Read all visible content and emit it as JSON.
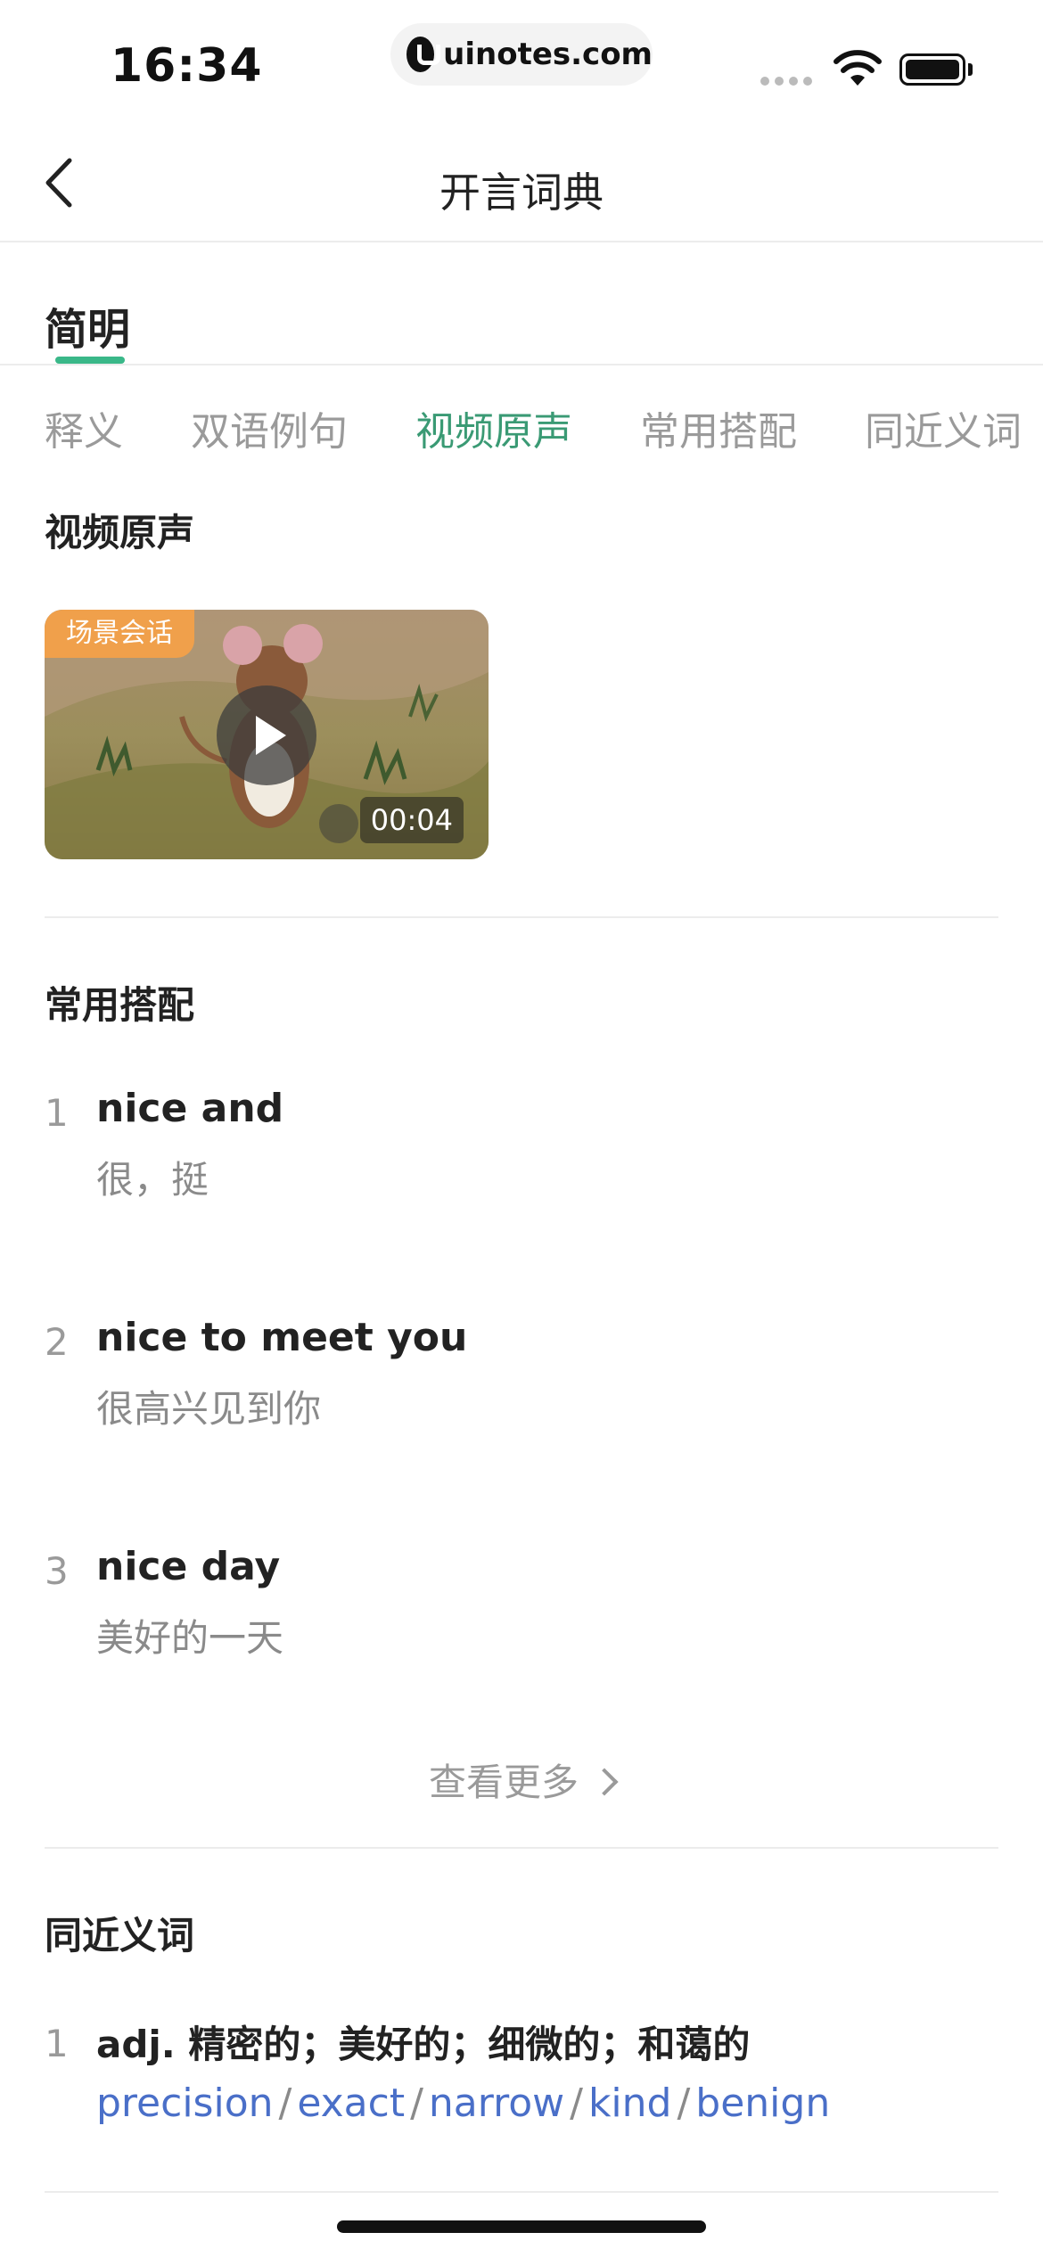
{
  "status_bar": {
    "time": "16:34",
    "url": "uinotes.com"
  },
  "nav": {
    "title": "开言词典"
  },
  "simple_tab": "简明",
  "section_tabs": [
    {
      "label": "释义",
      "active": false
    },
    {
      "label": "双语例句",
      "active": false
    },
    {
      "label": "视频原声",
      "active": true
    },
    {
      "label": "常用搭配",
      "active": false
    },
    {
      "label": "同近义词",
      "active": false
    }
  ],
  "video_section": {
    "heading": "视频原声",
    "badge": "场景会话",
    "duration": "00:04"
  },
  "collocations": {
    "heading": "常用搭配",
    "items": [
      {
        "num": "1",
        "en": "nice and",
        "cn": "很，挺"
      },
      {
        "num": "2",
        "en": "nice to meet you",
        "cn": "很高兴见到你"
      },
      {
        "num": "3",
        "en": "nice day",
        "cn": "美好的一天"
      }
    ],
    "more_label": "查看更多"
  },
  "synonyms": {
    "heading": "同近义词",
    "items": [
      {
        "num": "1",
        "definition": "adj. 精密的；美好的；细微的；和蔼的",
        "words": [
          "precision",
          "exact",
          "narrow",
          "kind",
          "benign"
        ]
      }
    ]
  },
  "colors": {
    "accent": "#3ab889",
    "active_tab": "#3a9a74",
    "link": "#4a6fc8",
    "badge": "#f0a04b"
  }
}
